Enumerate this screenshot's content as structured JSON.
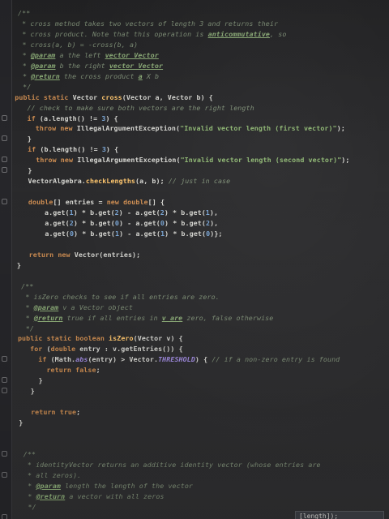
{
  "editor": {
    "lines": [
      {
        "indent": 2,
        "segments": [
          [
            "cm",
            "/**"
          ]
        ]
      },
      {
        "indent": 3,
        "segments": [
          [
            "cm",
            "* cross method takes two vectors of length 3 and returns their"
          ]
        ]
      },
      {
        "indent": 3,
        "segments": [
          [
            "cm",
            "* cross product. Note that this operation is "
          ],
          [
            "cm-tag",
            "anticommutative"
          ],
          [
            "cm",
            ", so"
          ]
        ]
      },
      {
        "indent": 3,
        "segments": [
          [
            "cm",
            "* cross(a, b) = -cross(b, a)"
          ]
        ]
      },
      {
        "indent": 3,
        "segments": [
          [
            "cm",
            "* "
          ],
          [
            "cm-tag",
            "@param"
          ],
          [
            "cm",
            " a the left "
          ],
          [
            "cm-tag",
            "vector Vector"
          ]
        ]
      },
      {
        "indent": 3,
        "segments": [
          [
            "cm",
            "* "
          ],
          [
            "cm-tag",
            "@param"
          ],
          [
            "cm",
            " b the right "
          ],
          [
            "cm-tag",
            "vector Vector"
          ]
        ]
      },
      {
        "indent": 3,
        "segments": [
          [
            "cm",
            "* "
          ],
          [
            "cm-tag",
            "@return"
          ],
          [
            "cm",
            " the cross product "
          ],
          [
            "cm-tag",
            "a"
          ],
          [
            "cm",
            " X b"
          ]
        ]
      },
      {
        "indent": 3,
        "segments": [
          [
            "cm",
            "*/"
          ]
        ]
      },
      {
        "indent": 1,
        "segments": [
          [
            "kw",
            "public static "
          ],
          [
            "tx",
            "Vector "
          ],
          [
            "fn",
            "cross"
          ],
          [
            "tx",
            "(Vector a, Vector b) {"
          ]
        ]
      },
      {
        "indent": 4,
        "segments": [
          [
            "cm",
            "// check to make sure both vectors are the right length"
          ]
        ]
      },
      {
        "indent": 4,
        "segments": [
          [
            "kw",
            "if "
          ],
          [
            "tx",
            "(a.length() != "
          ],
          [
            "num",
            "3"
          ],
          [
            "tx",
            ") {"
          ]
        ]
      },
      {
        "indent": 6,
        "segments": [
          [
            "kw",
            "throw new "
          ],
          [
            "tx",
            "IllegalArgumentException("
          ],
          [
            "str",
            "\"Invalid vector length (first vector)\""
          ],
          [
            "tx",
            ");"
          ]
        ]
      },
      {
        "indent": 4,
        "segments": [
          [
            "tx",
            "}"
          ]
        ]
      },
      {
        "indent": 4,
        "segments": [
          [
            "kw",
            "if "
          ],
          [
            "tx",
            "(b.length() != "
          ],
          [
            "num",
            "3"
          ],
          [
            "tx",
            ") {"
          ]
        ]
      },
      {
        "indent": 6,
        "segments": [
          [
            "kw",
            "throw new "
          ],
          [
            "tx",
            "IllegalArgumentException("
          ],
          [
            "str",
            "\"Invalid vector length (second vector)\""
          ],
          [
            "tx",
            ");"
          ]
        ]
      },
      {
        "indent": 4,
        "segments": [
          [
            "tx",
            "}"
          ]
        ]
      },
      {
        "indent": 4,
        "segments": [
          [
            "tx",
            "VectorAlgebra."
          ],
          [
            "fn",
            "checkLengths"
          ],
          [
            "tx",
            "(a, b); "
          ],
          [
            "cm",
            "// just in case"
          ]
        ]
      },
      {
        "indent": 0,
        "segments": []
      },
      {
        "indent": 4,
        "segments": [
          [
            "kw",
            "double"
          ],
          [
            "tx",
            "[] entries = "
          ],
          [
            "kw",
            "new double"
          ],
          [
            "tx",
            "[] {"
          ]
        ]
      },
      {
        "indent": 8,
        "segments": [
          [
            "tx",
            "a.get("
          ],
          [
            "num",
            "1"
          ],
          [
            "tx",
            ") * b.get("
          ],
          [
            "num",
            "2"
          ],
          [
            "tx",
            ") - a.get("
          ],
          [
            "num",
            "2"
          ],
          [
            "tx",
            ") * b.get("
          ],
          [
            "num",
            "1"
          ],
          [
            "tx",
            "),"
          ]
        ]
      },
      {
        "indent": 8,
        "segments": [
          [
            "tx",
            "a.get("
          ],
          [
            "num",
            "2"
          ],
          [
            "tx",
            ") * b.get("
          ],
          [
            "num",
            "0"
          ],
          [
            "tx",
            ") - a.get("
          ],
          [
            "num",
            "0"
          ],
          [
            "tx",
            ") * b.get("
          ],
          [
            "num",
            "2"
          ],
          [
            "tx",
            "),"
          ]
        ]
      },
      {
        "indent": 8,
        "segments": [
          [
            "tx",
            "a.get("
          ],
          [
            "num",
            "0"
          ],
          [
            "tx",
            ") * b.get("
          ],
          [
            "num",
            "1"
          ],
          [
            "tx",
            ") - a.get("
          ],
          [
            "num",
            "1"
          ],
          [
            "tx",
            ") * b.get("
          ],
          [
            "num",
            "0"
          ],
          [
            "tx",
            ")};"
          ]
        ]
      },
      {
        "indent": 0,
        "segments": []
      },
      {
        "indent": 4,
        "segments": [
          [
            "kw",
            "return new "
          ],
          [
            "tx",
            "Vector(entries);"
          ]
        ]
      },
      {
        "indent": 1,
        "segments": [
          [
            "tx",
            "}"
          ]
        ]
      },
      {
        "indent": 0,
        "segments": []
      },
      {
        "indent": 2,
        "segments": [
          [
            "cm",
            "/**"
          ]
        ]
      },
      {
        "indent": 3,
        "segments": [
          [
            "cm",
            "* isZero checks to see if all entries are zero."
          ]
        ]
      },
      {
        "indent": 3,
        "segments": [
          [
            "cm",
            "* "
          ],
          [
            "cm-tag",
            "@param"
          ],
          [
            "cm",
            " v a Vector object"
          ]
        ]
      },
      {
        "indent": 3,
        "segments": [
          [
            "cm",
            "* "
          ],
          [
            "cm-tag",
            "@return"
          ],
          [
            "cm",
            " true if all entries in "
          ],
          [
            "cm-tag",
            "v are"
          ],
          [
            "cm",
            " zero, false otherwise"
          ]
        ]
      },
      {
        "indent": 3,
        "segments": [
          [
            "cm",
            "*/"
          ]
        ]
      },
      {
        "indent": 1,
        "segments": [
          [
            "kw",
            "public static boolean "
          ],
          [
            "fn",
            "isZero"
          ],
          [
            "tx",
            "(Vector v) {"
          ]
        ]
      },
      {
        "indent": 4,
        "segments": [
          [
            "kw",
            "for "
          ],
          [
            "tx",
            "("
          ],
          [
            "kw",
            "double "
          ],
          [
            "tx",
            "entry : v.getEntries()) {"
          ]
        ]
      },
      {
        "indent": 6,
        "segments": [
          [
            "kw",
            "if "
          ],
          [
            "tx",
            "(Math."
          ],
          [
            "cst",
            "abs"
          ],
          [
            "tx",
            "(entry) > Vector."
          ],
          [
            "cst",
            "THRESHOLD"
          ],
          [
            "tx",
            ") { "
          ],
          [
            "cm",
            "// if a non-zero entry is found"
          ]
        ]
      },
      {
        "indent": 8,
        "segments": [
          [
            "kw",
            "return false"
          ],
          [
            "tx",
            ";"
          ]
        ]
      },
      {
        "indent": 6,
        "segments": [
          [
            "tx",
            "}"
          ]
        ]
      },
      {
        "indent": 4,
        "segments": [
          [
            "tx",
            "}"
          ]
        ]
      },
      {
        "indent": 0,
        "segments": []
      },
      {
        "indent": 4,
        "segments": [
          [
            "kw",
            "return true"
          ],
          [
            "tx",
            ";"
          ]
        ]
      },
      {
        "indent": 1,
        "segments": [
          [
            "tx",
            "}"
          ]
        ]
      },
      {
        "indent": 0,
        "segments": []
      },
      {
        "indent": 0,
        "segments": []
      },
      {
        "indent": 2,
        "segments": [
          [
            "cm",
            "/**"
          ]
        ]
      },
      {
        "indent": 3,
        "segments": [
          [
            "cm",
            "* identityVector returns an additive identity vector (whose entries are"
          ]
        ]
      },
      {
        "indent": 3,
        "segments": [
          [
            "cm",
            "* all zeros)."
          ]
        ]
      },
      {
        "indent": 3,
        "segments": [
          [
            "cm",
            "* "
          ],
          [
            "cm-tag",
            "@param"
          ],
          [
            "cm",
            " length the length of the vector"
          ]
        ]
      },
      {
        "indent": 3,
        "segments": [
          [
            "cm",
            "* "
          ],
          [
            "cm-tag",
            "@return"
          ],
          [
            "cm",
            " a vector with all zeros"
          ]
        ]
      },
      {
        "indent": 3,
        "segments": [
          [
            "cm",
            "*/"
          ]
        ]
      }
    ],
    "tooltip": "[length]);"
  }
}
